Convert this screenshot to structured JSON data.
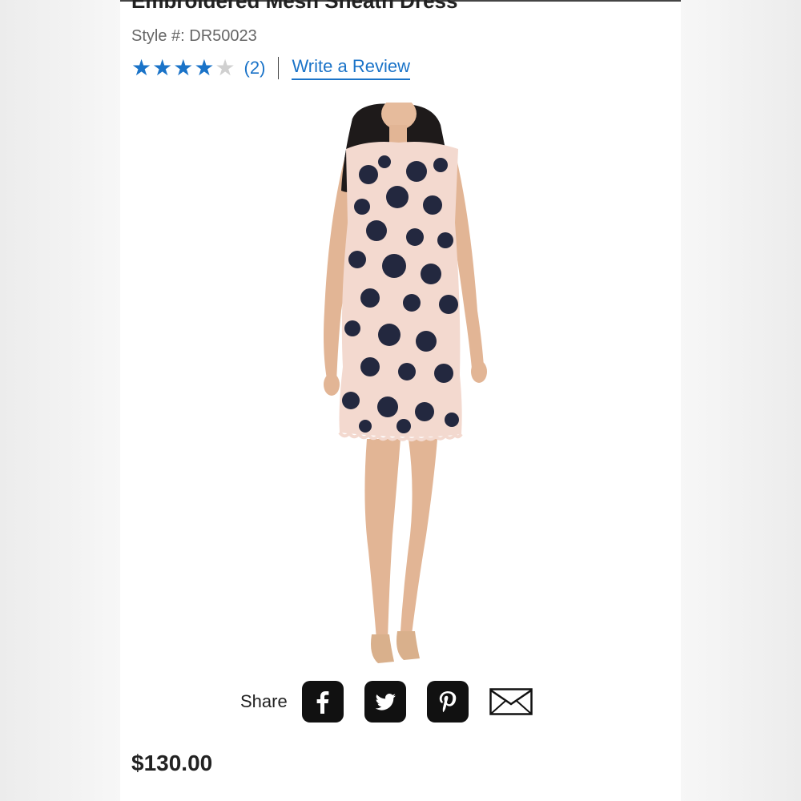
{
  "product": {
    "title": "Embroidered Mesh Sheath Dress",
    "style_label": "Style #: DR50023",
    "rating": {
      "stars_filled": 4,
      "stars_total": 5,
      "count_text": "(2)"
    },
    "write_review_label": "Write a Review",
    "price": "$130.00"
  },
  "share": {
    "label": "Share",
    "icons": [
      "facebook-icon",
      "twitter-icon",
      "pinterest-icon",
      "email-icon"
    ]
  },
  "colors": {
    "accent": "#1a73c8",
    "text": "#222222",
    "dress_navy": "#23283f",
    "dress_blush": "#f3d9cf",
    "skin": "#e2b595"
  }
}
